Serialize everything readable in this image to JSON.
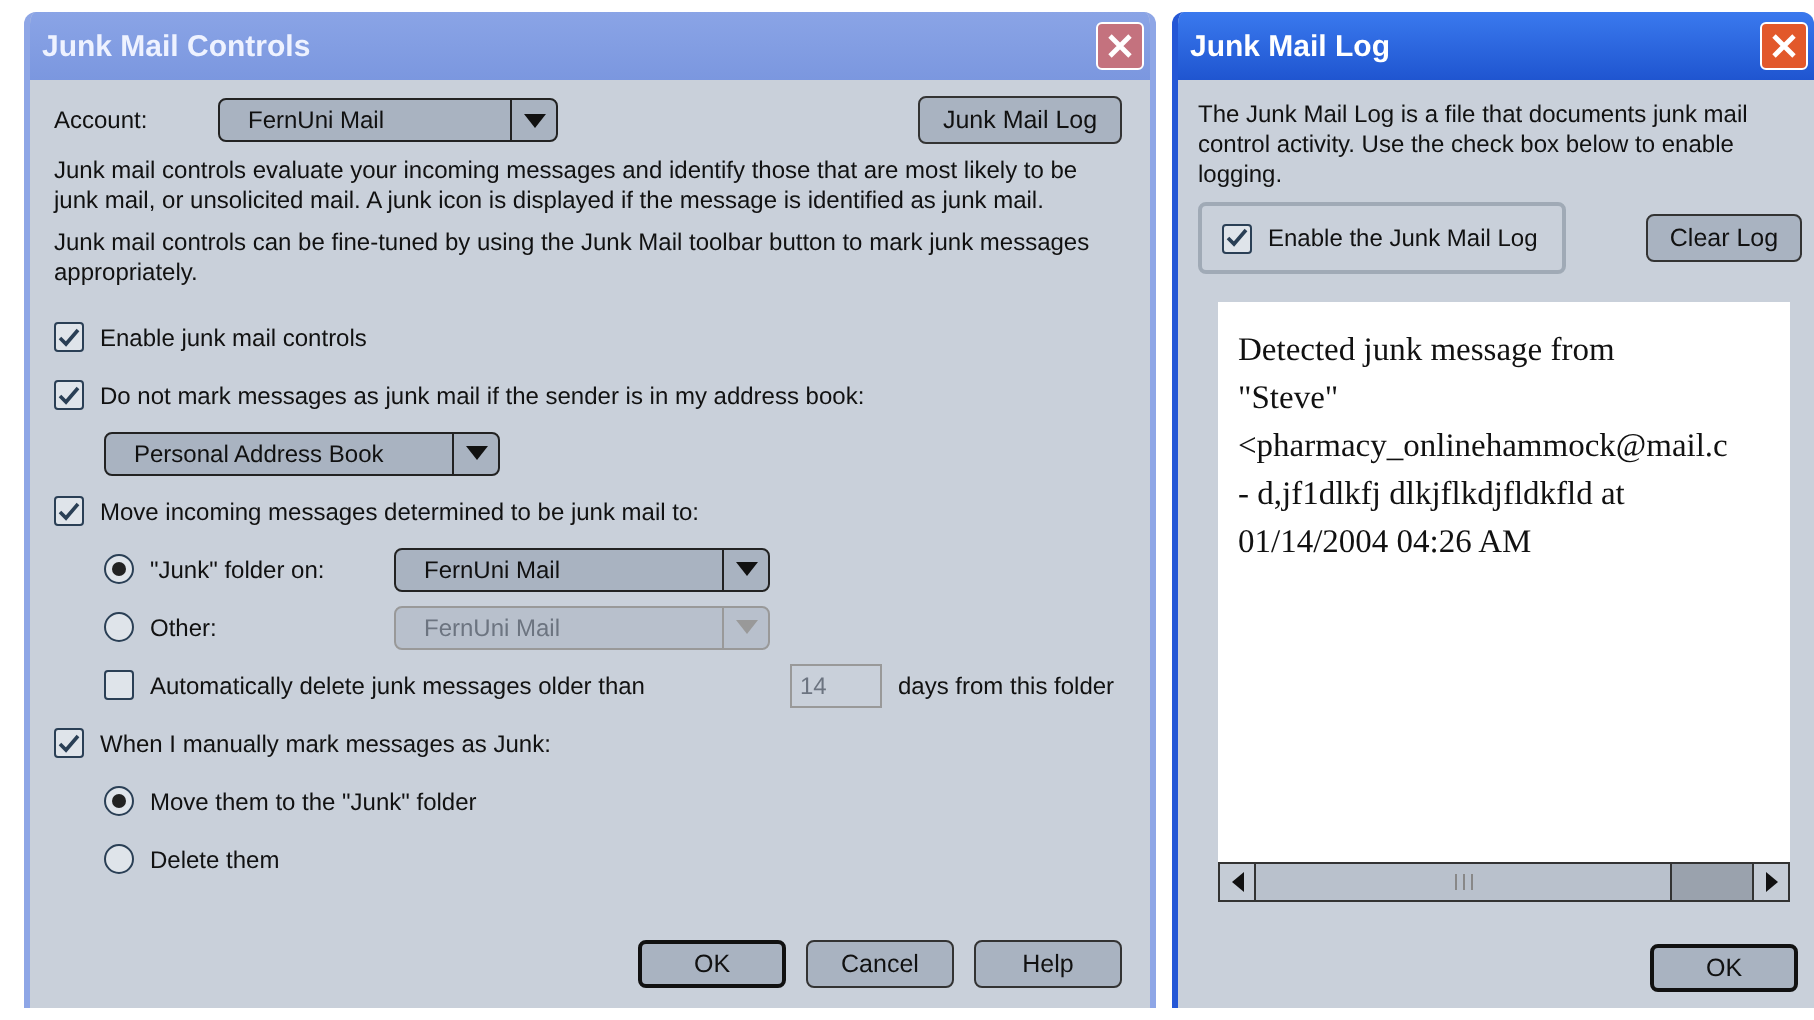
{
  "controls_window": {
    "title": "Junk Mail Controls",
    "account": {
      "label": "Account:",
      "value": "FernUni Mail"
    },
    "log_button": "Junk Mail Log",
    "description": [
      "Junk mail controls evaluate your incoming messages and identify those that are most likely to be junk mail, or unsolicited mail. A junk icon is displayed if the message is identified as junk mail.",
      "Junk mail controls can be fine-tuned by using the Junk Mail toolbar button to mark junk messages appropriately."
    ],
    "options": [
      {
        "kind": "checkbox",
        "label": "Enable junk mail controls",
        "checked": true
      },
      {
        "kind": "checkbox",
        "label": "Do not mark messages as junk mail if the sender is in my address book:",
        "checked": true
      },
      {
        "kind": "dropdown",
        "value": "Personal Address Book",
        "disabled": false
      },
      {
        "kind": "checkbox",
        "label": "Move incoming messages determined to be junk mail to:",
        "checked": true
      },
      {
        "kind": "radio",
        "label": "\"Junk\" folder on:",
        "selected": true,
        "dropdown": {
          "value": "FernUni Mail",
          "disabled": false
        }
      },
      {
        "kind": "radio",
        "label": "Other:",
        "selected": false,
        "dropdown": {
          "value": "FernUni Mail",
          "disabled": true
        }
      },
      {
        "kind": "days",
        "label": "Automatically delete junk messages older than",
        "checked": false,
        "value": "14",
        "disabled": true,
        "suffix": "days from this folder"
      },
      {
        "kind": "checkbox",
        "label": "When I manually mark messages as Junk:",
        "checked": true
      },
      {
        "kind": "radio",
        "label": "Move them to the \"Junk\" folder",
        "selected": true
      },
      {
        "kind": "radio",
        "label": "Delete them",
        "selected": false
      }
    ],
    "buttons": [
      {
        "label": "OK",
        "default": true
      },
      {
        "label": "Cancel",
        "default": false
      },
      {
        "label": "Help",
        "default": false
      }
    ]
  },
  "log_window": {
    "title": "Junk Mail Log",
    "description": "The Junk Mail Log is a file that documents junk mail control activity. Use the check box below to enable logging.",
    "enable": {
      "label": "Enable the Junk Mail Log",
      "checked": true
    },
    "clear_button": "Clear Log",
    "log_lines": [
      "Detected junk message from",
      "\"Steve\"",
      "<pharmacy_onlinehammock@mail.c",
      "- d,jf1dlkfj dlkjflkdjfldkfld at",
      "01/14/2004 04:26 AM"
    ],
    "ok_button": "OK"
  }
}
